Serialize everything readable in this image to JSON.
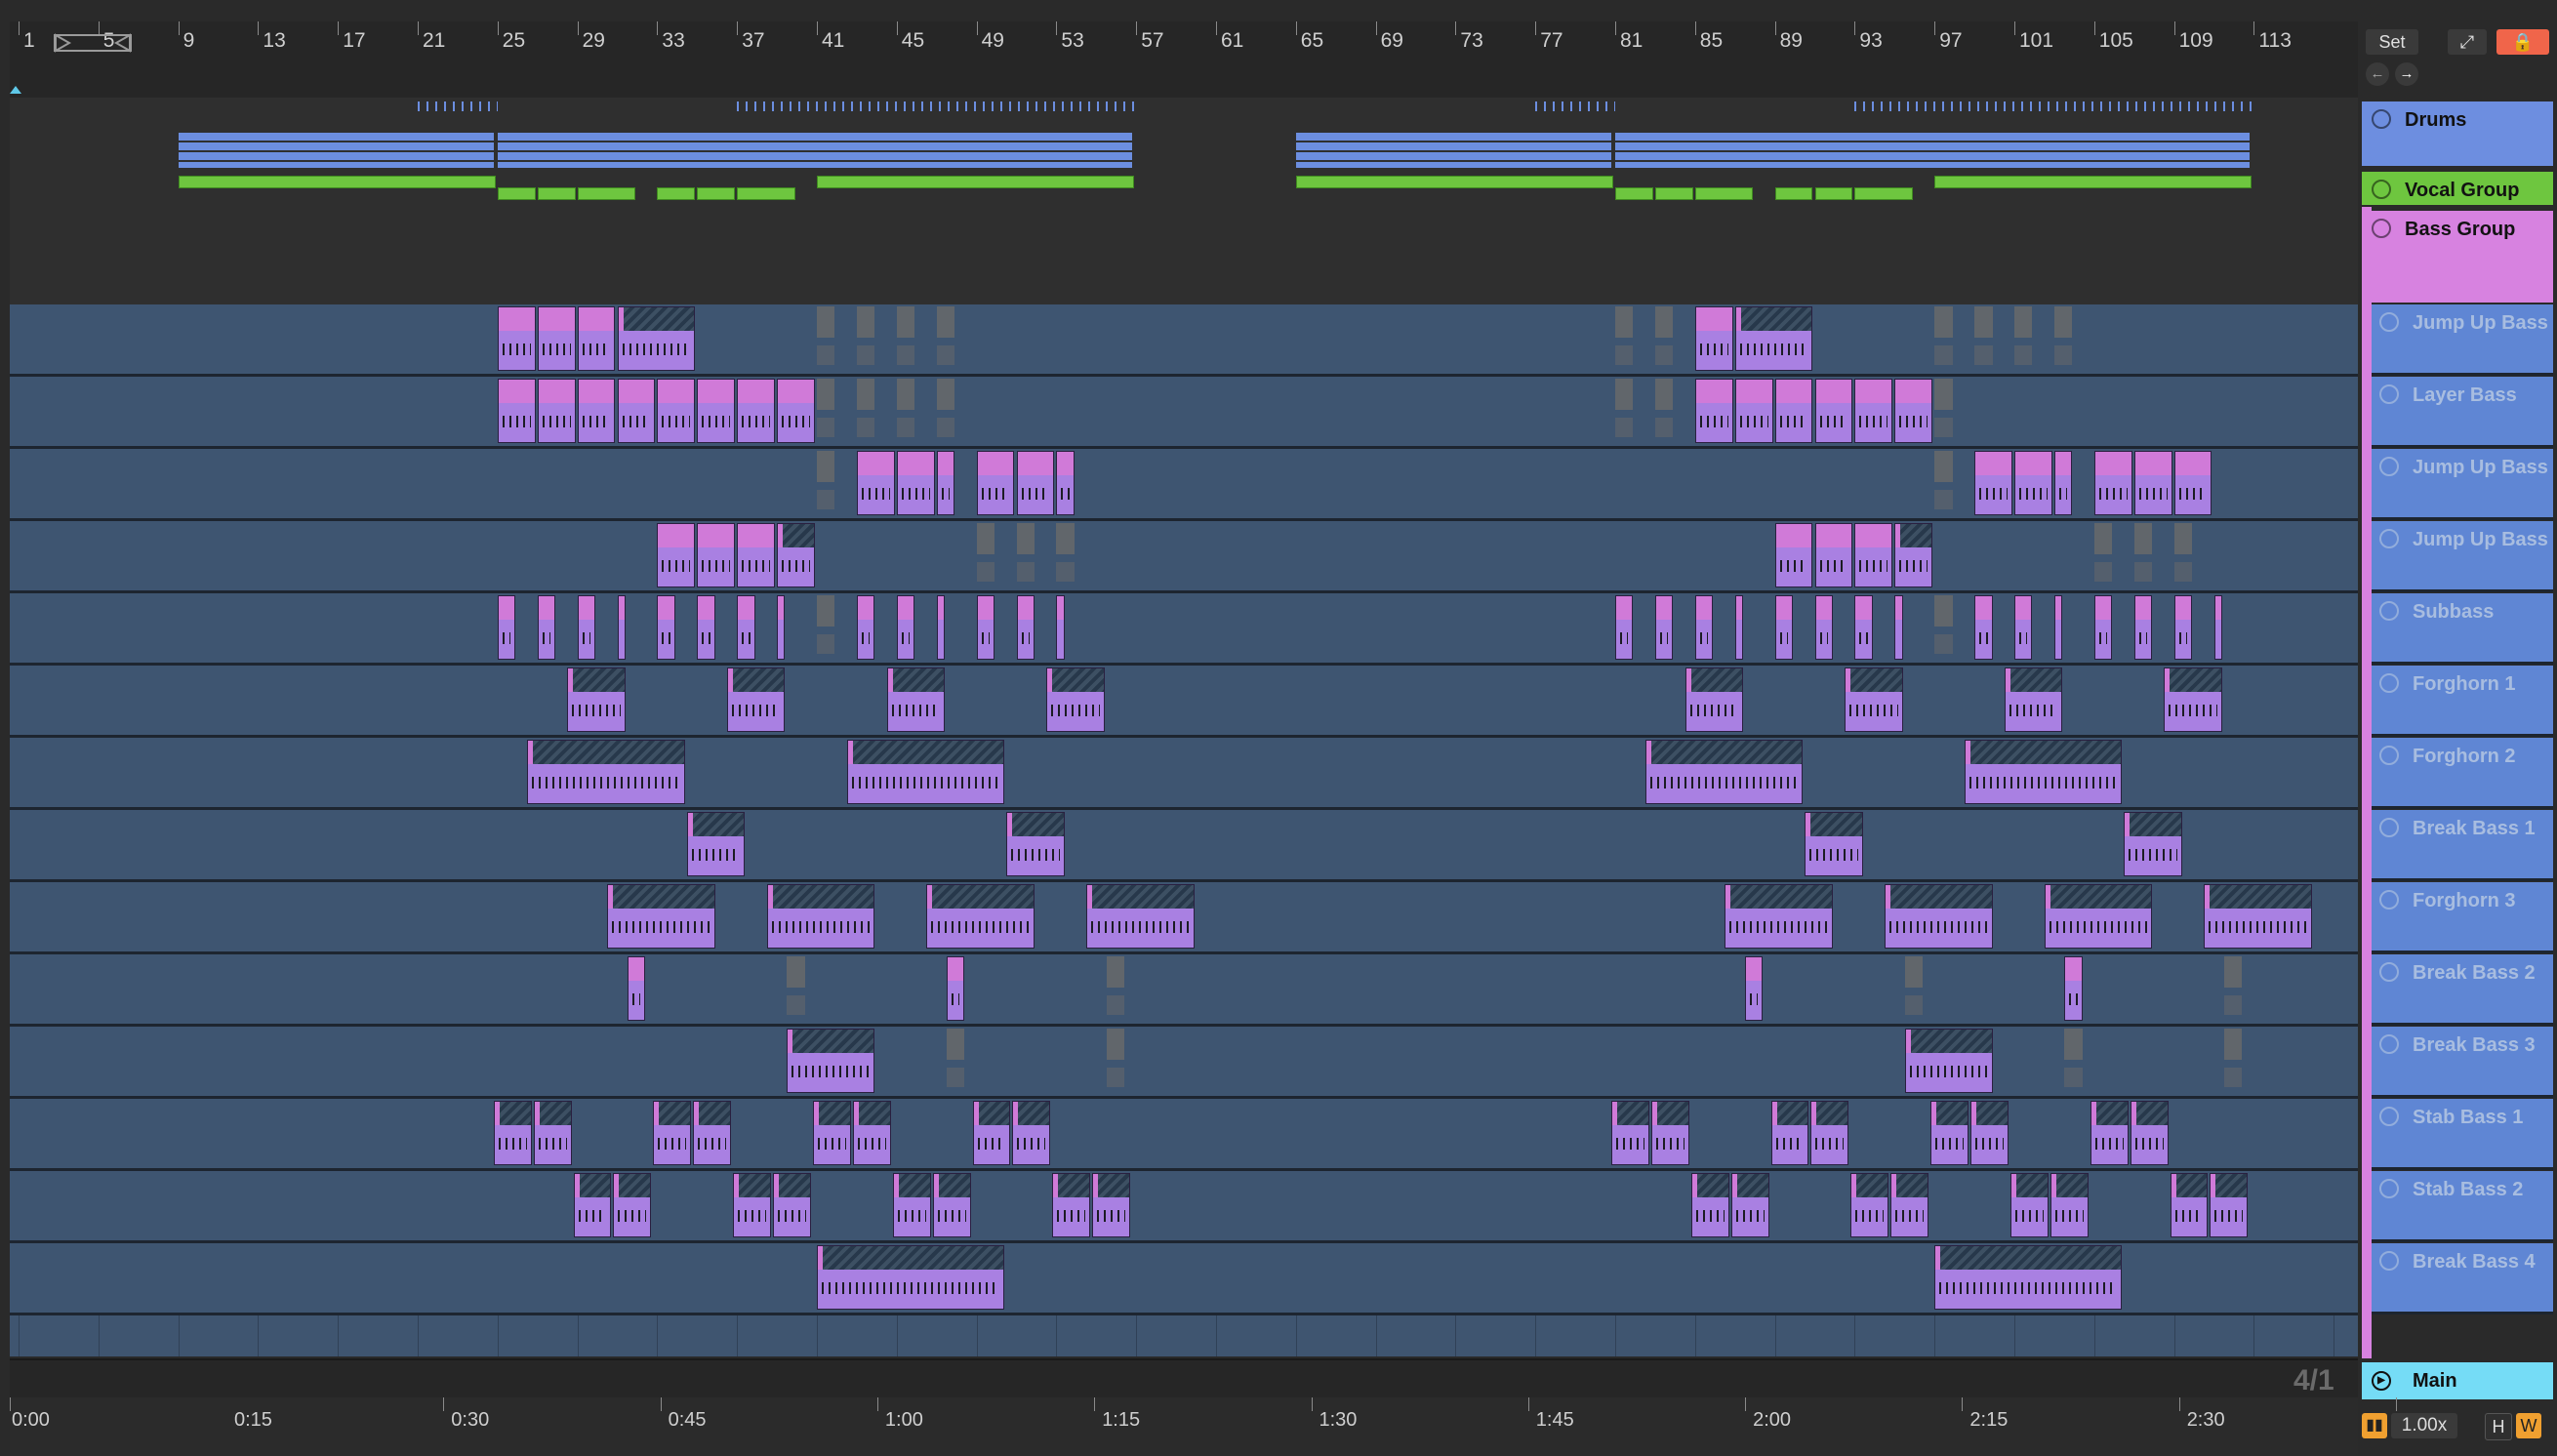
{
  "arrangement": {
    "bar_numbers": [
      "1",
      "5",
      "9",
      "13",
      "17",
      "21",
      "25",
      "29",
      "33",
      "37",
      "41",
      "45",
      "49",
      "53",
      "57",
      "61",
      "65",
      "69",
      "73",
      "77",
      "81",
      "85",
      "89",
      "93",
      "97",
      "101",
      "105",
      "109",
      "113"
    ],
    "time_labels": [
      "0:00",
      "0:15",
      "0:30",
      "0:45",
      "1:00",
      "1:15",
      "1:30",
      "1:45",
      "2:00",
      "2:15",
      "2:30"
    ],
    "position_display": "4/1"
  },
  "controls": {
    "set_label": "Set",
    "tempo_display": "1.00x",
    "h_label": "H",
    "w_label": "W"
  },
  "groups": [
    {
      "name": "Drums",
      "color": "#6d8ee0"
    },
    {
      "name": "Vocal Group",
      "color": "#6ec63f"
    },
    {
      "name": "Bass Group",
      "color": "#d782e0"
    }
  ],
  "tracks": [
    {
      "name": "Jump Up Bass"
    },
    {
      "name": "Layer Bass"
    },
    {
      "name": "Jump Up Bass"
    },
    {
      "name": "Jump Up Bass"
    },
    {
      "name": "Subbass"
    },
    {
      "name": "Forghorn 1"
    },
    {
      "name": "Forghorn 2"
    },
    {
      "name": "Break Bass 1"
    },
    {
      "name": "Forghorn 3"
    },
    {
      "name": "Break Bass 2"
    },
    {
      "name": "Break Bass 3"
    },
    {
      "name": "Stab Bass 1"
    },
    {
      "name": "Stab Bass 2"
    },
    {
      "name": "Break Bass 4"
    }
  ],
  "main_track": {
    "name": "Main",
    "color": "#75dcf6"
  },
  "colors": {
    "clip_pink": "#d07ad8",
    "clip_purple": "#a980e2",
    "lane_blue": "#3e5571",
    "header_blue": "#5f86d4"
  }
}
